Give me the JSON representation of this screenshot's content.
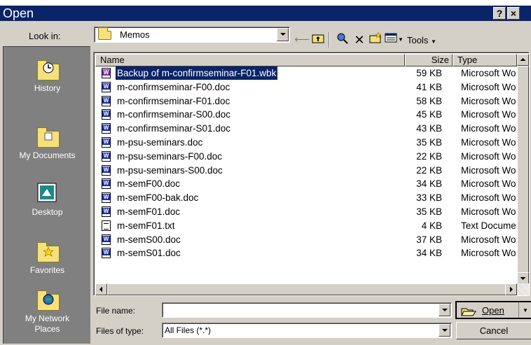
{
  "dialog": {
    "title": "Open",
    "help_label": "?",
    "close_label": "×"
  },
  "look_in": {
    "label": "Look in:",
    "value": "Memos"
  },
  "toolbar": {
    "tools_label": "Tools"
  },
  "places": [
    {
      "label": "History",
      "icon": "history-icon"
    },
    {
      "label": "My Documents",
      "icon": "my-documents-icon"
    },
    {
      "label": "Desktop",
      "icon": "desktop-icon"
    },
    {
      "label": "Favorites",
      "icon": "favorites-icon"
    },
    {
      "label": "My Network Places",
      "icon": "network-places-icon"
    }
  ],
  "columns": {
    "name": "Name",
    "size": "Size",
    "type": "Type"
  },
  "files": [
    {
      "name": "Backup of m-confirmseminar-F01.wbk",
      "size": "59 KB",
      "type": "Microsoft Wo",
      "kind": "wbk",
      "selected": true
    },
    {
      "name": "m-confirmseminar-F00.doc",
      "size": "41 KB",
      "type": "Microsoft Wo",
      "kind": "doc"
    },
    {
      "name": "m-confirmseminar-F01.doc",
      "size": "58 KB",
      "type": "Microsoft Wo",
      "kind": "doc"
    },
    {
      "name": "m-confirmseminar-S00.doc",
      "size": "45 KB",
      "type": "Microsoft Wo",
      "kind": "doc"
    },
    {
      "name": "m-confirmseminar-S01.doc",
      "size": "43 KB",
      "type": "Microsoft Wo",
      "kind": "doc"
    },
    {
      "name": "m-psu-seminars.doc",
      "size": "35 KB",
      "type": "Microsoft Wo",
      "kind": "doc"
    },
    {
      "name": "m-psu-seminars-F00.doc",
      "size": "22 KB",
      "type": "Microsoft Wo",
      "kind": "doc"
    },
    {
      "name": "m-psu-seminars-S00.doc",
      "size": "22 KB",
      "type": "Microsoft Wo",
      "kind": "doc"
    },
    {
      "name": "m-semF00.doc",
      "size": "34 KB",
      "type": "Microsoft Wo",
      "kind": "doc"
    },
    {
      "name": "m-semF00-bak.doc",
      "size": "33 KB",
      "type": "Microsoft Wo",
      "kind": "doc"
    },
    {
      "name": "m-semF01.doc",
      "size": "35 KB",
      "type": "Microsoft Wo",
      "kind": "doc"
    },
    {
      "name": "m-semF01.txt",
      "size": "4 KB",
      "type": "Text Docume",
      "kind": "txt"
    },
    {
      "name": "m-semS00.doc",
      "size": "37 KB",
      "type": "Microsoft Wo",
      "kind": "doc"
    },
    {
      "name": "m-semS01.doc",
      "size": "34 KB",
      "type": "Microsoft Wo",
      "kind": "doc"
    }
  ],
  "file_name": {
    "label": "File name:",
    "value": ""
  },
  "file_type": {
    "label": "Files of type:",
    "value": "All Files (*.*)"
  },
  "buttons": {
    "open": "Open",
    "cancel": "Cancel"
  },
  "colors": {
    "titlebar": "#0a246a",
    "dialog_bg": "#d4d0c8",
    "places_bg": "#808080",
    "selection": "#0a246a"
  }
}
